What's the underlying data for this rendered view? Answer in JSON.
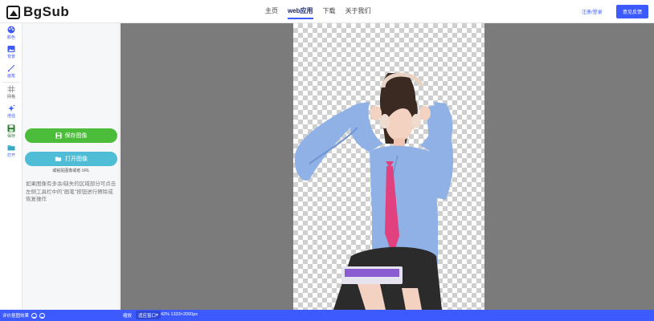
{
  "header": {
    "logo_text": "BgSub",
    "nav": [
      "主页",
      "web应用",
      "下载",
      "关于我们"
    ],
    "active_nav": "web应用",
    "login_label": "注册/登录",
    "feedback_label": "意见反馈"
  },
  "rail": {
    "tools": [
      {
        "id": "palette",
        "label": "颜色"
      },
      {
        "id": "image",
        "label": "背景"
      },
      {
        "id": "brush",
        "label": "画笔"
      },
      {
        "id": "grid",
        "label": "网格"
      },
      {
        "id": "sparkle",
        "label": "增强"
      },
      {
        "id": "save",
        "label": "保存"
      },
      {
        "id": "open",
        "label": "打开"
      }
    ]
  },
  "panel": {
    "save_label": "保存图像",
    "open_label": "打开图像",
    "paste_hint": "或粘贴图像或者 URL",
    "tip": "如果图像有多余/缺失的区域部分可点击左侧工具栏中的\"画笔\"按钮进行擦除或恢复操作"
  },
  "statusbar": {
    "feedback_text": "评价抠图效果",
    "zoom_label": "缩放",
    "zoom_value": "适应窗口",
    "info": "42%  1333×2000px"
  },
  "colors": {
    "accent": "#3d5afe",
    "save_green": "#4bbd3a",
    "open_cyan": "#4fbdd6",
    "canvas_gray": "#7b7b7b"
  }
}
